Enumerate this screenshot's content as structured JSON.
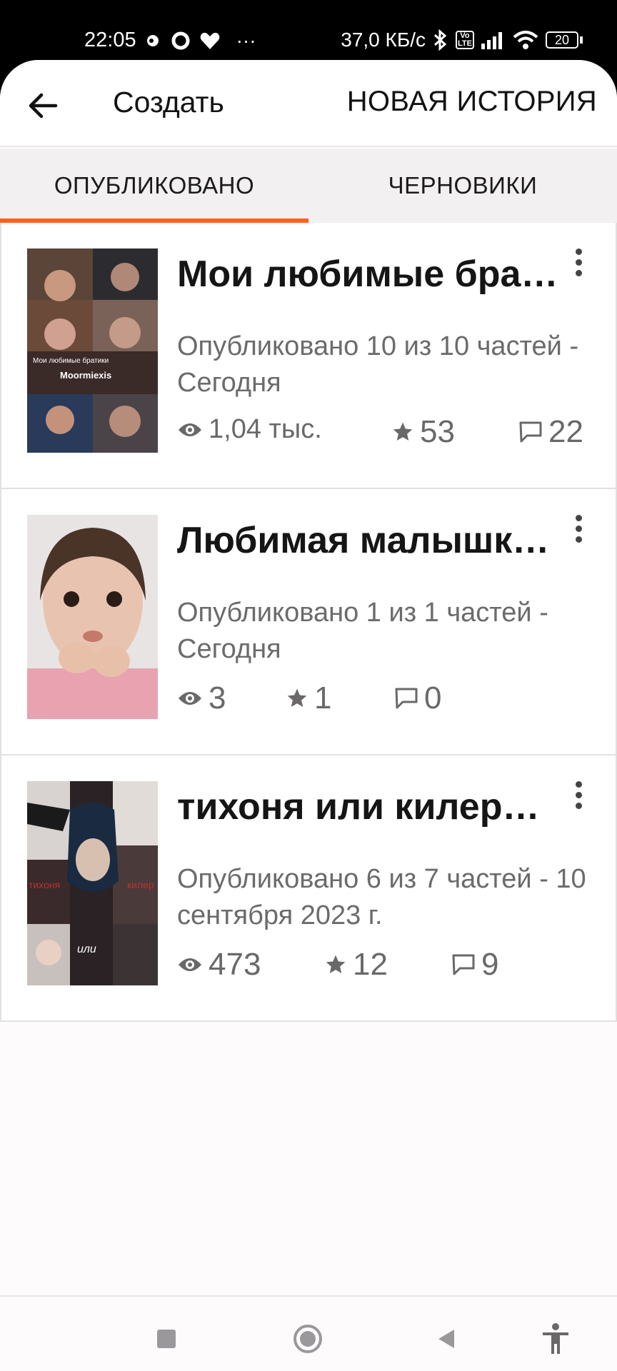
{
  "status_bar": {
    "time": "22:05",
    "dots": "···",
    "speed": "37,0 КБ/с",
    "volte": "Vo LTE",
    "battery": "20"
  },
  "appbar": {
    "title": "Создать",
    "action": "НОВАЯ ИСТОРИЯ"
  },
  "tabs": [
    {
      "label": "ОПУБЛИКОВАНО",
      "active": true
    },
    {
      "label": "ЧЕРНОВИКИ",
      "active": false
    }
  ],
  "stories": [
    {
      "title": "Мои любимые бра…",
      "subtitle": "Опубликовано 10 из 10 частей - Сегодня",
      "views": "1,04 тыс.",
      "votes": "53",
      "comments": "22",
      "cover_text_1": "Мои любимые братики",
      "cover_text_2": "Moormiexis"
    },
    {
      "title": "Любимая малышк…",
      "subtitle": "Опубликовано 1 из 1 частей - Сегодня",
      "views": "3",
      "votes": "1",
      "comments": "0"
    },
    {
      "title": "тихоня или килер…",
      "subtitle": "Опубликовано 6 из 7 частей - 10 сентября 2023 г.",
      "views": "473",
      "votes": "12",
      "comments": "9",
      "cover_text_1": "тихоня",
      "cover_text_2": "килер",
      "cover_text_3": "или"
    }
  ],
  "colors": {
    "accent": "#ff5f1f",
    "stat_gray": "#6a6869"
  }
}
